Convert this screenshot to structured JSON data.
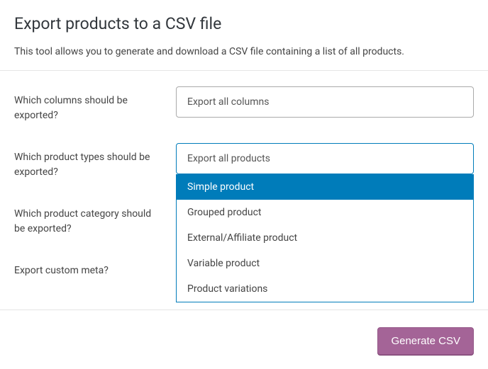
{
  "header": {
    "title": "Export products to a CSV file",
    "description": "This tool allows you to generate and download a CSV file containing a list of all products."
  },
  "form": {
    "columns": {
      "label": "Which columns should be exported?",
      "value": "Export all columns"
    },
    "product_types": {
      "label": "Which product types should be exported?",
      "value": "Export all products",
      "options": [
        "Simple product",
        "Grouped product",
        "External/Affiliate product",
        "Variable product",
        "Product variations"
      ]
    },
    "category": {
      "label": "Which product category should be exported?"
    },
    "custom_meta": {
      "label": "Export custom meta?"
    }
  },
  "actions": {
    "generate_label": "Generate CSV"
  }
}
